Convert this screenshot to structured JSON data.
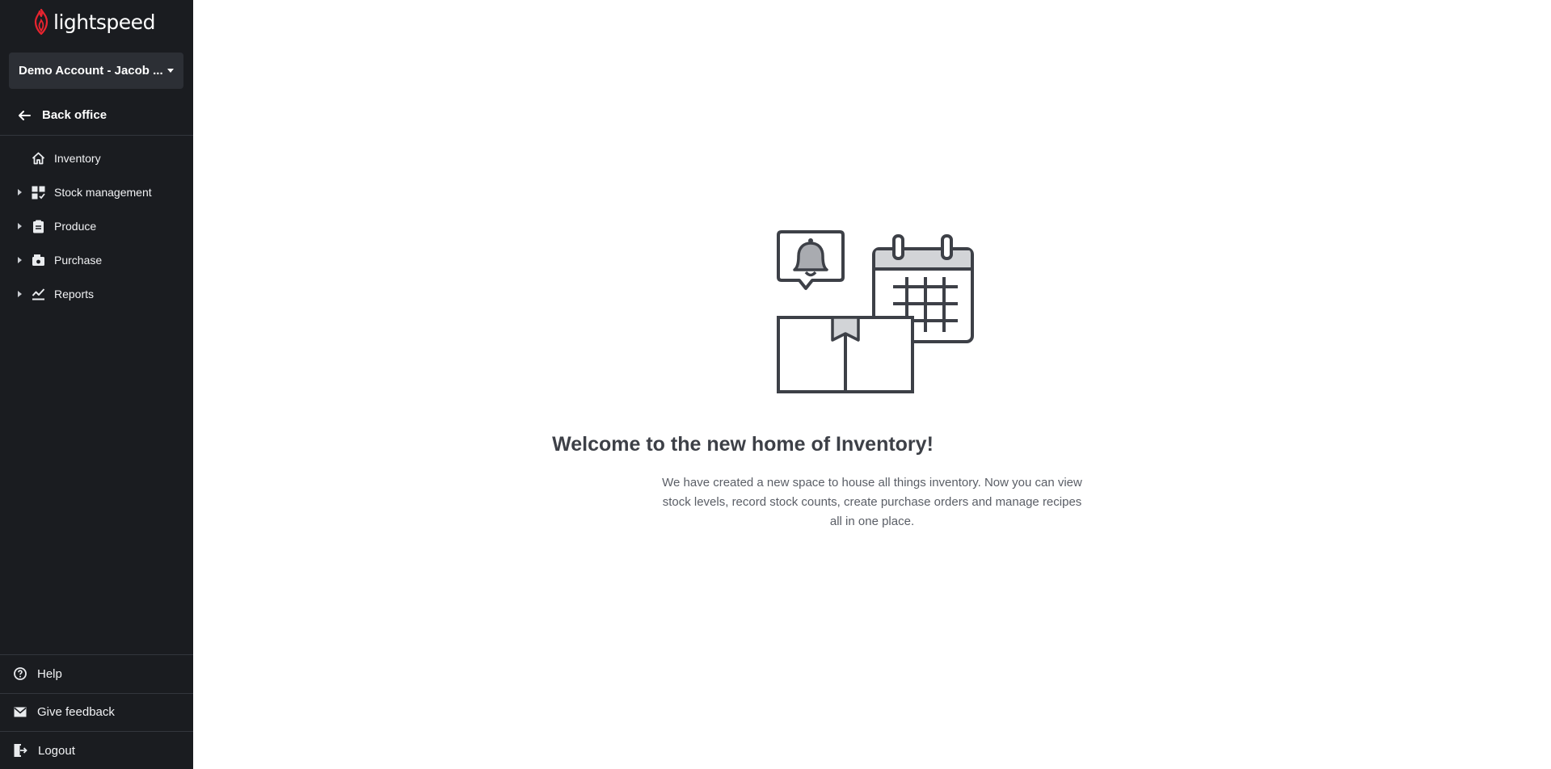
{
  "brand": {
    "name": "lightspeed",
    "accent": "#e8242f"
  },
  "account": {
    "name": "Demo Account - Jacob ..."
  },
  "back_office": {
    "label": "Back office",
    "icon": "arrow-left-icon"
  },
  "nav": {
    "items": [
      {
        "label": "Inventory",
        "icon": "home-icon",
        "expandable": false
      },
      {
        "label": "Stock management",
        "icon": "stock-grid-icon",
        "expandable": true
      },
      {
        "label": "Produce",
        "icon": "clipboard-icon",
        "expandable": true
      },
      {
        "label": "Purchase",
        "icon": "register-icon",
        "expandable": true
      },
      {
        "label": "Reports",
        "icon": "chart-icon",
        "expandable": true
      }
    ]
  },
  "bottom_nav": {
    "help": {
      "label": "Help",
      "icon": "question-circle-icon"
    },
    "feedback": {
      "label": "Give feedback",
      "icon": "envelope-icon"
    },
    "logout": {
      "label": "Logout",
      "icon": "logout-icon"
    }
  },
  "welcome": {
    "title": "Welcome to the new home of Inventory!",
    "body": "We have created a new space to house all things inventory. Now you can view stock levels, record stock counts, create purchase orders and manage recipes all in one place."
  },
  "colors": {
    "sidebar_bg": "#1a1c20",
    "account_bg": "#2c2f35",
    "title": "#3d4047",
    "body_text": "#5a5e66"
  }
}
